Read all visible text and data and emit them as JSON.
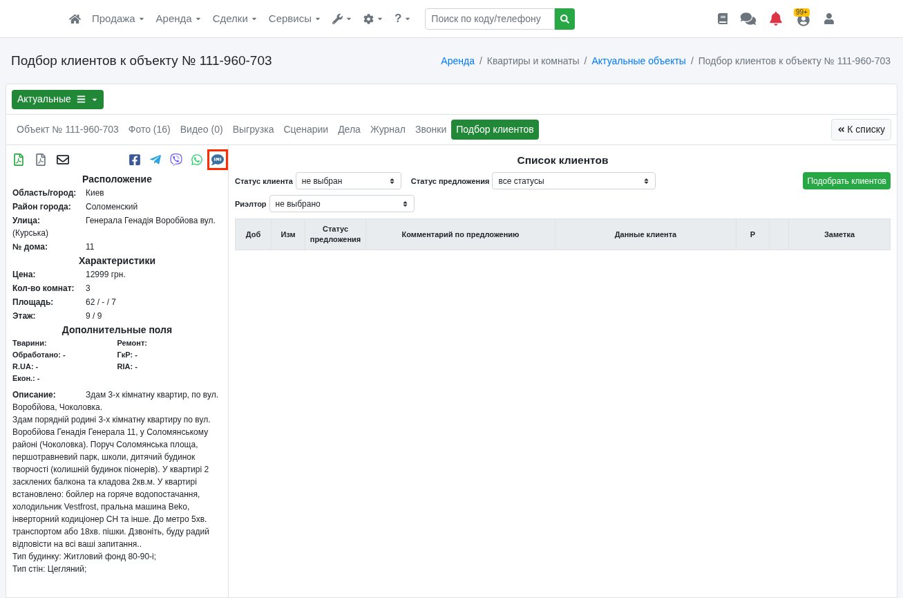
{
  "navbar": {
    "items": [
      {
        "kind": "home"
      },
      {
        "kind": "menu",
        "label": "Продажа"
      },
      {
        "kind": "menu",
        "label": "Аренда"
      },
      {
        "kind": "menu",
        "label": "Сделки"
      },
      {
        "kind": "menu",
        "label": "Сервисы"
      },
      {
        "kind": "tools"
      },
      {
        "kind": "settings"
      },
      {
        "kind": "help",
        "label": "?"
      }
    ],
    "search": {
      "placeholder": "Поиск по коду/телефону"
    },
    "right_icons": [
      {
        "kind": "book"
      },
      {
        "kind": "chat"
      },
      {
        "kind": "bell"
      },
      {
        "kind": "avatar",
        "badge": "99+"
      },
      {
        "kind": "user"
      }
    ]
  },
  "page": {
    "title": "Подбор клиентов к объекту № 111-960-703",
    "breadcrumb_separator": "/",
    "breadcrumbs": [
      {
        "label": "Аренда",
        "link": true
      },
      {
        "label": "Квартиры и комнаты",
        "link": false
      },
      {
        "label": "Актуальные объекты",
        "link": true
      },
      {
        "label": "Подбор клиентов к объекту № 111-960-703",
        "link": false
      }
    ]
  },
  "filter_button": {
    "label": "Актуальные"
  },
  "tabs": [
    {
      "label": "Объект № 111-960-703",
      "selected": false
    },
    {
      "label": "Фото (16)",
      "selected": false
    },
    {
      "label": "Видео (0)",
      "selected": false
    },
    {
      "label": "Выгрузка",
      "selected": false
    },
    {
      "label": "Сценарии",
      "selected": false
    },
    {
      "label": "Дела",
      "selected": false
    },
    {
      "label": "Журнал",
      "selected": false
    },
    {
      "label": "Звонки",
      "selected": false
    },
    {
      "label": "Подбор клиентов",
      "selected": true
    }
  ],
  "back_button": {
    "label": "К списку"
  },
  "object_panel": {
    "actions": [
      {
        "kind": "pdf-color",
        "highlighted": false
      },
      {
        "kind": "pdf",
        "highlighted": false
      },
      {
        "kind": "mail",
        "highlighted": false
      }
    ],
    "share": [
      {
        "kind": "facebook",
        "highlighted": false
      },
      {
        "kind": "telegram",
        "highlighted": false
      },
      {
        "kind": "viber",
        "highlighted": false
      },
      {
        "kind": "whatsapp",
        "highlighted": false
      },
      {
        "kind": "sms",
        "highlighted": true
      }
    ],
    "location": {
      "title": "Расположение",
      "rows": [
        {
          "label": "Область/город:",
          "value": "Киев"
        },
        {
          "label": "Район города:",
          "value": "Соломенский"
        },
        {
          "label": "Улица:",
          "value": "Генерала Генадія Воробйова вул.",
          "extra": "(Курська)"
        },
        {
          "label": "№ дома:",
          "value": "11"
        }
      ]
    },
    "specs": {
      "title": "Характеристики",
      "rows": [
        {
          "label": "Цена:",
          "value": "12999 грн."
        },
        {
          "label": "Кол-во комнат:",
          "value": "3"
        },
        {
          "label": "Площадь:",
          "value": "62 / - / 7"
        },
        {
          "label": "Этаж:",
          "value": "9 / 9"
        }
      ]
    },
    "extra_fields": {
      "title": "Дополнительные поля",
      "items": [
        {
          "text": "Тварини:"
        },
        {
          "text": "Ремонт:"
        },
        {
          "text": "Обработано: -"
        },
        {
          "text": "ГкР: -"
        },
        {
          "text": "R.UA: -"
        },
        {
          "text": "RIA: -"
        },
        {
          "text": "Екон.: -"
        }
      ]
    },
    "description": {
      "label": "Описание:",
      "lead": "Здам 3-х кімнатну квартир, по вул. Воробйова, Чоколовка.",
      "paragraphs": [
        "Здам порядній родині 3-х кімнатну квартиру по вул. Воробйова Генадія Генерала 11, у Соломянському районі (Чоколовка). Поруч Соломянська площа, першотравневий парк, школи, дитячий будинок творчості (колишній будинок піонерів). У квартирі 2 засклених балкона та кладова 2кв.м. У квартирі встановлено: бойлер на горяче водопостачання, холодильник Vestfrost, пральна машина Beko, інверторний кодиціонер CH та інше. До метро 5хв. транспортом або 18хв. пішки. Дзвоніть, буду радий відповісти на всі ваші запитання..",
        "Тип будинку: Житловий фонд 80-90-і;",
        "Тип стін: Цегляний;"
      ]
    }
  },
  "clients": {
    "title": "Список клиентов",
    "filters": [
      {
        "label": "Статус клиента",
        "value": "не выбран"
      },
      {
        "label": "Статус предложения",
        "value": "все статусы"
      },
      {
        "label": "Риэлтор",
        "value": "не выбрано"
      }
    ],
    "match_button": "Подобрать клиентов",
    "table": {
      "columns": [
        "Доб",
        "Изм",
        "Статус предложения",
        "Комментарий по предложению",
        "Данные клиента",
        "Р",
        "",
        "Заметка"
      ]
    }
  }
}
